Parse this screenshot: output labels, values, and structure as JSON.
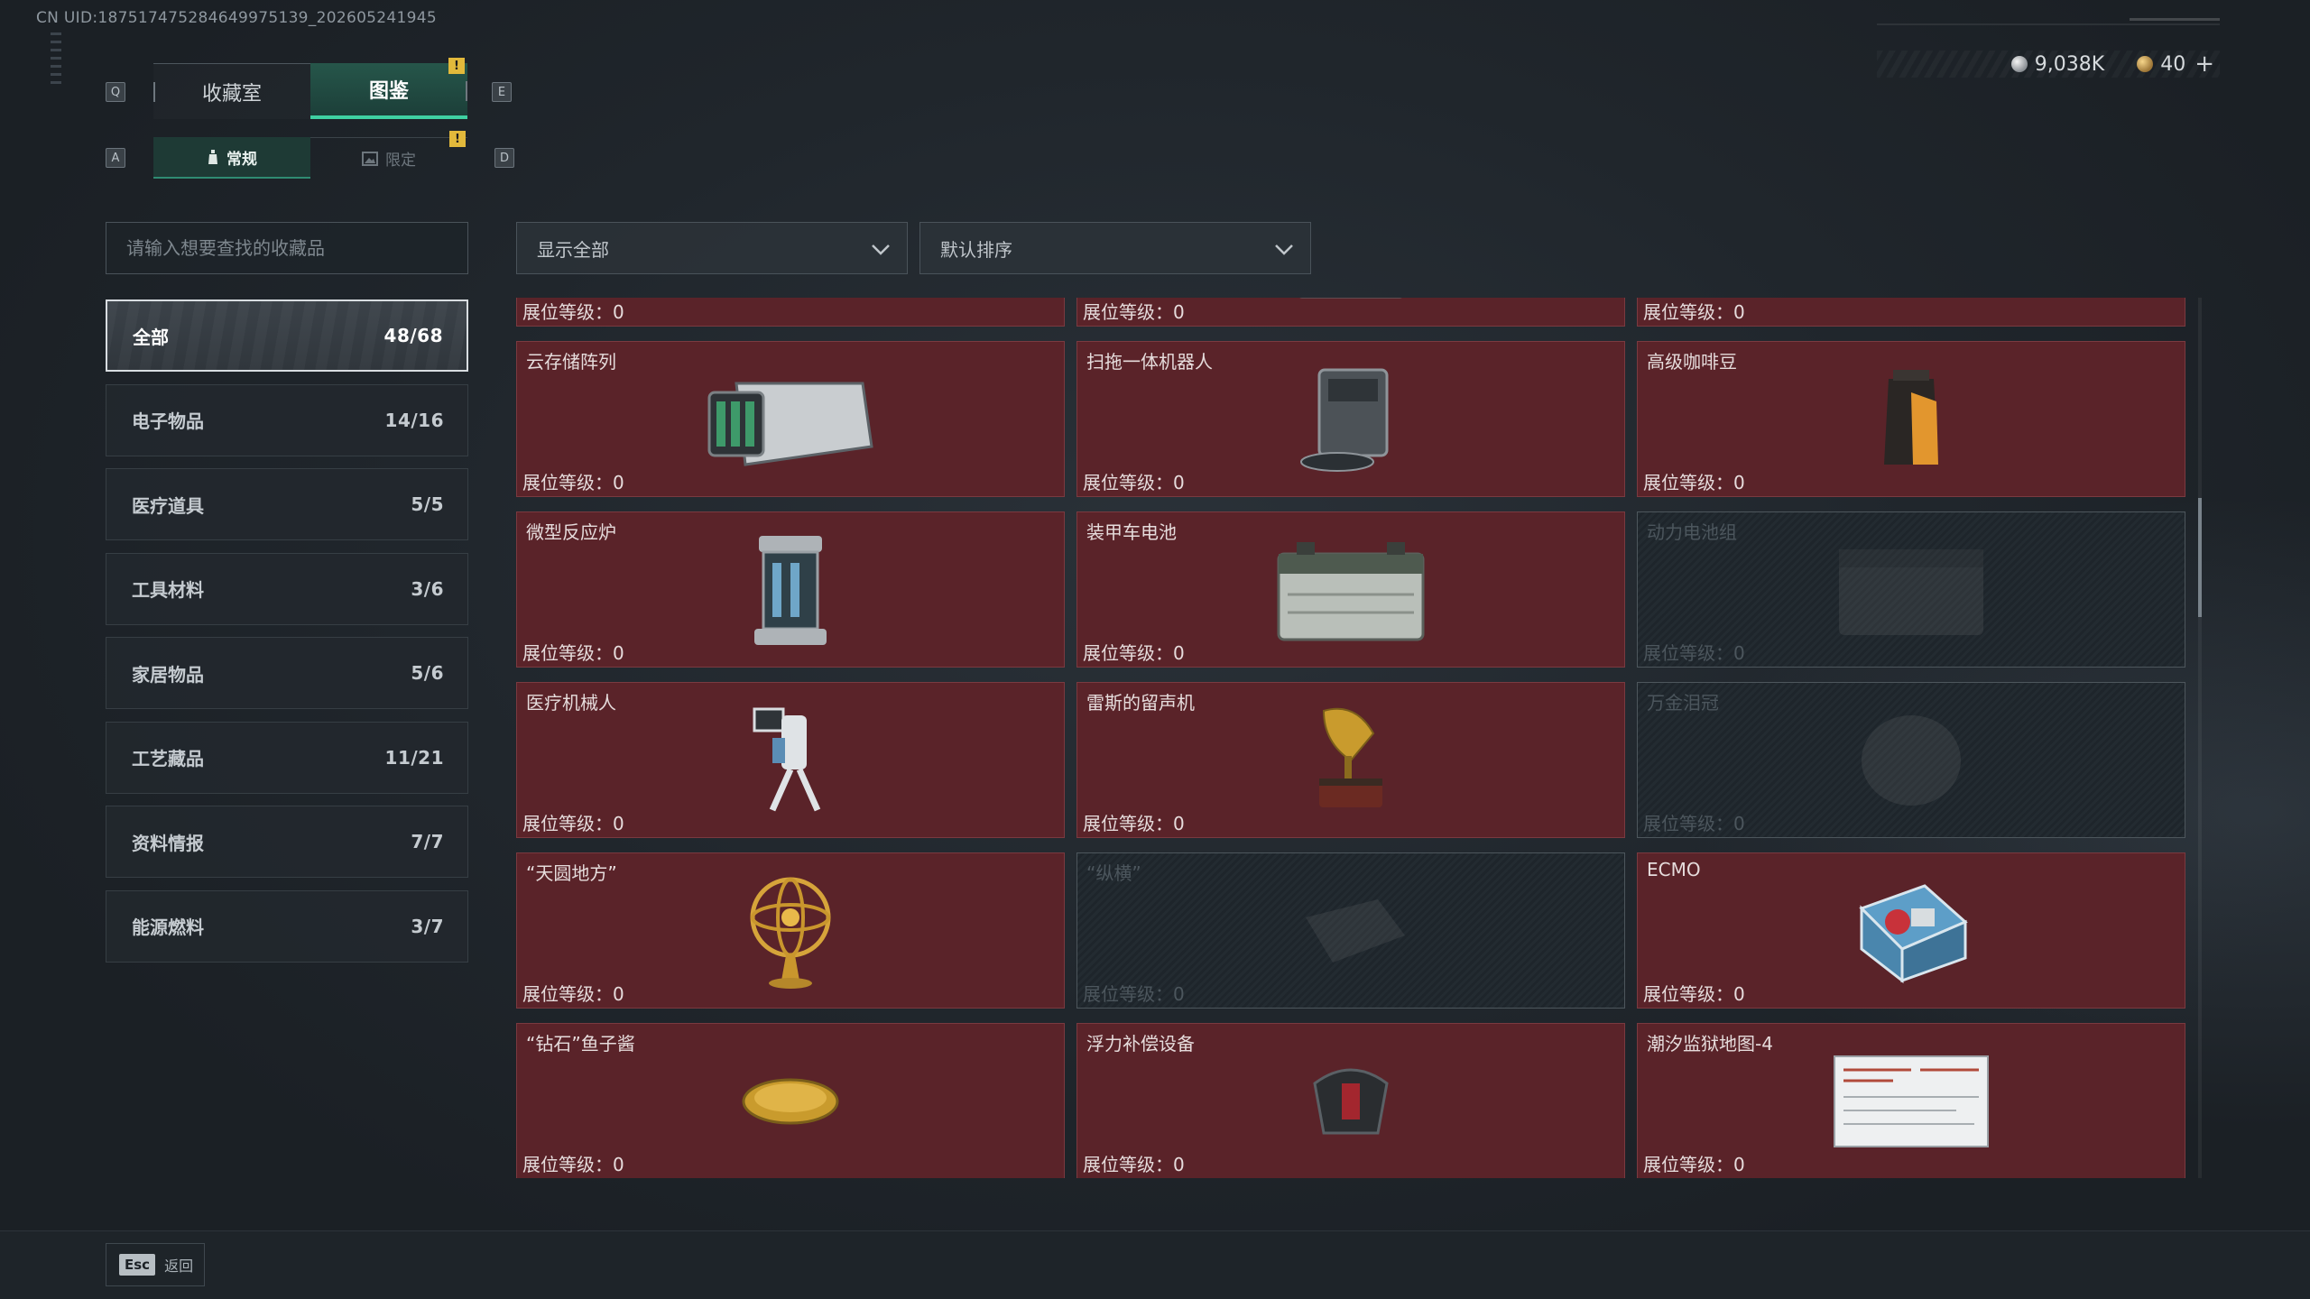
{
  "uid": "CN UID:187517475284649975139_202605241945",
  "currency": {
    "silver_value": "9,038K",
    "gold_value": "40",
    "add_label": "+"
  },
  "keys": {
    "prev_tab": "Q",
    "next_tab": "E",
    "prev_sub": "A",
    "next_sub": "D"
  },
  "tabs": [
    {
      "label": "收藏室",
      "active": false
    },
    {
      "label": "图鉴",
      "active": true,
      "badge": "!"
    }
  ],
  "subtabs": [
    {
      "label": "常规",
      "active": true
    },
    {
      "label": "限定",
      "active": false,
      "badge": "!"
    }
  ],
  "search": {
    "placeholder": "请输入想要查找的收藏品"
  },
  "filter": {
    "value": "显示全部"
  },
  "sort": {
    "value": "默认排序"
  },
  "categories": [
    {
      "label": "全部",
      "count": "48/68",
      "active": true
    },
    {
      "label": "电子物品",
      "count": "14/16"
    },
    {
      "label": "医疗道具",
      "count": "5/5"
    },
    {
      "label": "工具材料",
      "count": "3/6"
    },
    {
      "label": "家居物品",
      "count": "5/6"
    },
    {
      "label": "工艺藏品",
      "count": "11/21"
    },
    {
      "label": "资料情报",
      "count": "7/7"
    },
    {
      "label": "能源燃料",
      "count": "3/7"
    }
  ],
  "level_label": "展位等级：0",
  "items": [
    {
      "name": "",
      "icon": "jerrycan-icon",
      "locked": false
    },
    {
      "name": "",
      "icon": "portable-console-icon",
      "locked": false
    },
    {
      "name": "",
      "icon": "floor-washer-icon",
      "locked": false
    },
    {
      "name": "云存储阵列",
      "icon": "storage-array-icon",
      "locked": false
    },
    {
      "name": "扫拖一体机器人",
      "icon": "mop-robot-icon",
      "locked": false
    },
    {
      "name": "高级咖啡豆",
      "icon": "coffee-bag-icon",
      "locked": false
    },
    {
      "name": "微型反应炉",
      "icon": "reactor-icon",
      "locked": false
    },
    {
      "name": "装甲车电池",
      "icon": "battery-icon",
      "locked": false
    },
    {
      "name": "动力电池组",
      "icon": "battery-pack-icon",
      "locked": true
    },
    {
      "name": "医疗机械人",
      "icon": "medical-robot-icon",
      "locked": false
    },
    {
      "name": "雷斯的留声机",
      "icon": "gramophone-icon",
      "locked": false
    },
    {
      "name": "万金泪冠",
      "icon": "crown-icon",
      "locked": true
    },
    {
      "name": "“天圆地方”",
      "icon": "armillary-sphere-icon",
      "locked": false
    },
    {
      "name": "“纵横”",
      "icon": "chess-board-icon",
      "locked": true
    },
    {
      "name": "ECMO",
      "icon": "ecmo-icon",
      "locked": false
    },
    {
      "name": "“钻石”鱼子酱",
      "icon": "caviar-tin-icon",
      "locked": false
    },
    {
      "name": "浮力补偿设备",
      "icon": "buoyancy-device-icon",
      "locked": false
    },
    {
      "name": "潮汐监狱地图-4",
      "icon": "map-document-icon",
      "locked": false
    }
  ],
  "footer": {
    "esc_key": "Esc",
    "back_label": "返回"
  }
}
